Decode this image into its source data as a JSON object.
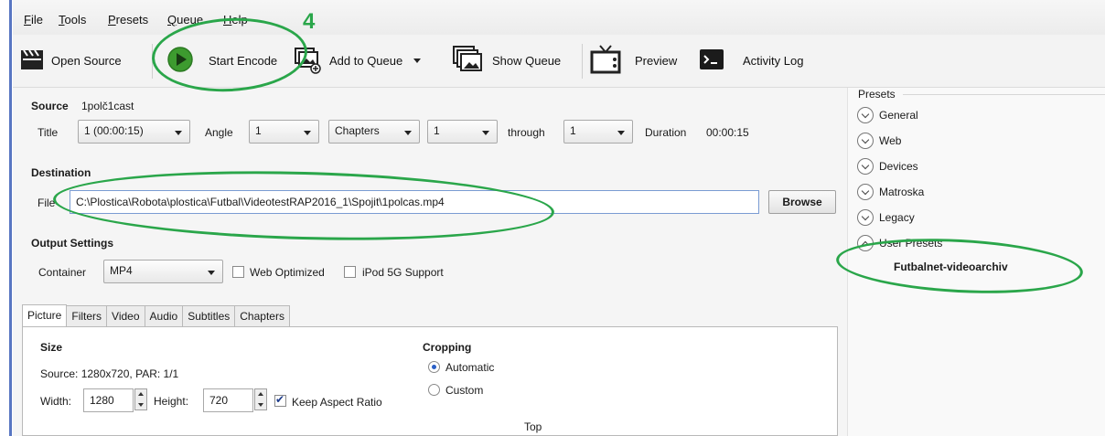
{
  "menu": [
    {
      "label": "File",
      "u": "F",
      "rest": "ile"
    },
    {
      "label": "Tools",
      "u": "T",
      "rest": "ools"
    },
    {
      "label": "Presets",
      "u": "P",
      "rest": "resets"
    },
    {
      "label": "Queue",
      "u": "Q",
      "rest": "ueue"
    },
    {
      "label": "Help",
      "u": "H",
      "rest": "elp"
    }
  ],
  "toolbar": {
    "open_source": "Open Source",
    "start_encode": "Start Encode",
    "add_to_queue": "Add to Queue",
    "show_queue": "Show Queue",
    "preview": "Preview",
    "activity_log": "Activity Log"
  },
  "annotation": {
    "step_number": "4",
    "color": "#2aa64a"
  },
  "source": {
    "label": "Source",
    "name": "1polč1cast",
    "title_label": "Title",
    "title_value": "1 (00:00:15)",
    "angle_label": "Angle",
    "angle_value": "1",
    "range_mode": "Chapters",
    "range_start": "1",
    "through_label": "through",
    "range_end": "1",
    "duration_label": "Duration",
    "duration_value": "00:00:15"
  },
  "destination": {
    "label": "Destination",
    "file_label": "File",
    "file_path": "C:\\Plostica\\Robota\\plostica\\Futbal\\VideotestRAP2016_1\\Spojit\\1polcas.mp4",
    "browse": "Browse"
  },
  "output": {
    "label": "Output Settings",
    "container_label": "Container",
    "container_value": "MP4",
    "web_optimized": "Web Optimized",
    "web_optimized_checked": false,
    "ipod": "iPod 5G Support",
    "ipod_checked": false
  },
  "tabs": [
    "Picture",
    "Filters",
    "Video",
    "Audio",
    "Subtitles",
    "Chapters"
  ],
  "picture": {
    "size_label": "Size",
    "source_info": "Source:  1280x720, PAR: 1/1",
    "width_label": "Width:",
    "width_value": "1280",
    "height_label": "Height:",
    "height_value": "720",
    "keep_aspect": "Keep Aspect Ratio",
    "keep_aspect_checked": true,
    "cropping_label": "Cropping",
    "automatic": "Automatic",
    "custom": "Custom",
    "top_label": "Top"
  },
  "presets": {
    "header": "Presets",
    "groups": [
      {
        "label": "General",
        "expanded": false
      },
      {
        "label": "Web",
        "expanded": false
      },
      {
        "label": "Devices",
        "expanded": false
      },
      {
        "label": "Matroska",
        "expanded": false
      },
      {
        "label": "Legacy",
        "expanded": false
      },
      {
        "label": "User Presets",
        "expanded": true
      }
    ],
    "selected_user_preset": "Futbalnet-videoarchiv"
  }
}
